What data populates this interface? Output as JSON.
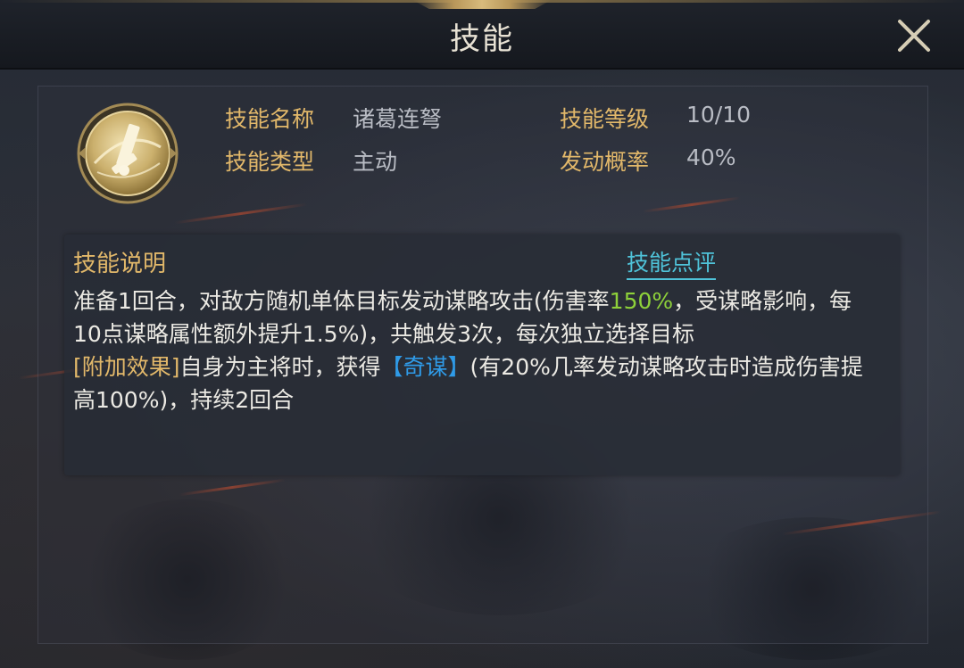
{
  "window": {
    "title": "技能",
    "close_icon": "close-x-icon"
  },
  "skill": {
    "icon": "crossbow-skill-icon",
    "name_label": "技能名称",
    "name_value": "诸葛连弩",
    "type_label": "技能类型",
    "type_value": "主动",
    "level_label": "技能等级",
    "level_value": "10/10",
    "rate_label": "发动概率",
    "rate_value": "40%"
  },
  "description": {
    "title": "技能说明",
    "review_link": "技能点评",
    "p1_a": "准备1回合，对敌方随机单体目标发动谋略攻击(伤害率",
    "p1_highlight": "150%",
    "p1_b": "，受谋略影响，每10点谋略属性额外提升1.5%)，共触发3次，每次独立选择目标",
    "p2_tag": "[附加效果]",
    "p2_a": "自身为主将时，获得",
    "p2_buff": "【奇谋】",
    "p2_b": "(有20%几率发动谋略攻击时造成伤害提高100%)，持续2回合"
  },
  "colors": {
    "gold_label": "#e2b86a",
    "value_gray": "#b9bcc4",
    "link_cyan": "#4fc3d9",
    "highlight_green": "#8ed13a",
    "buff_blue": "#2f9be8"
  }
}
